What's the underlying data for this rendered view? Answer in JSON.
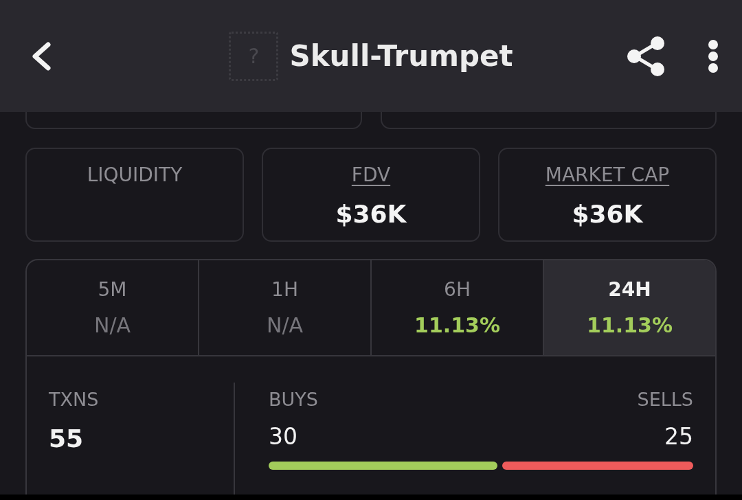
{
  "header": {
    "token_icon": "?",
    "title": "Skull-Trumpet"
  },
  "top_cards": [
    {
      "kind": "cut_off"
    },
    {
      "kind": "cut_off"
    }
  ],
  "metrics": [
    {
      "label": "LIQUIDITY",
      "underlined": false
    },
    {
      "label": "FDV",
      "underlined": true,
      "value": "$36K"
    },
    {
      "label": "MARKET CAP",
      "underlined": true,
      "value": "$36K"
    }
  ],
  "periods": [
    {
      "label": "5M",
      "value": "N/A",
      "positive": false,
      "selected": false
    },
    {
      "label": "1H",
      "value": "N/A",
      "positive": false,
      "selected": false
    },
    {
      "label": "6H",
      "value": "11.13%",
      "positive": true,
      "selected": false
    },
    {
      "label": "24H",
      "value": "11.13%",
      "positive": true,
      "selected": true
    }
  ],
  "transactions": {
    "txns_label": "TXNS",
    "txns_value": "55",
    "buys_label": "BUYS",
    "buys_value": "30",
    "sells_label": "SELLS",
    "sells_value": "25",
    "level": 0.545
  }
}
